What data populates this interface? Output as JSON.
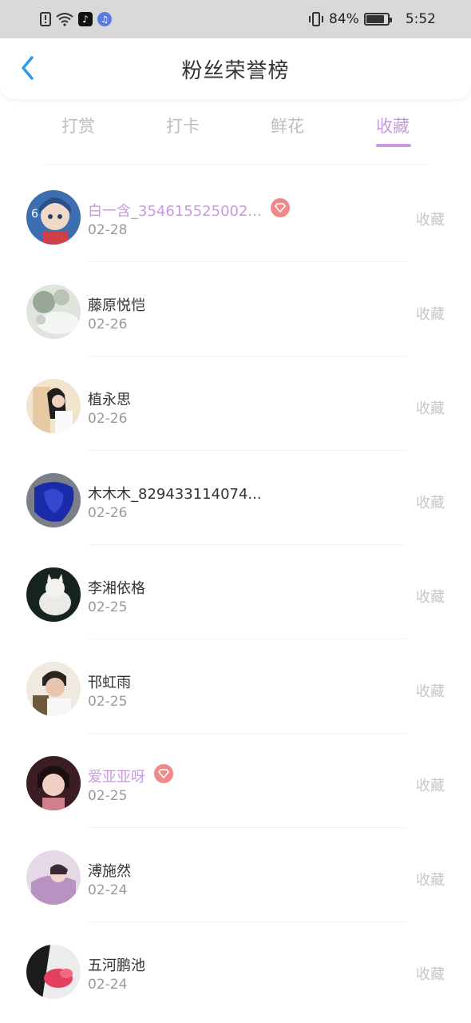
{
  "status_bar": {
    "battery": "84%",
    "time": "5:52",
    "icons": [
      "alert-icon",
      "wifi-icon",
      "tiktok-icon",
      "music-app-icon",
      "vibrate-icon",
      "battery-icon"
    ]
  },
  "header": {
    "title": "粉丝荣誉榜",
    "back_icon": "chevron-left-icon"
  },
  "tabs": [
    {
      "label": "打赏",
      "active": false
    },
    {
      "label": "打卡",
      "active": false
    },
    {
      "label": "鲜花",
      "active": false
    },
    {
      "label": "收藏",
      "active": true
    }
  ],
  "colors": {
    "accent": "#c79ae0",
    "vip_badge": "#f08a8a",
    "muted": "#c6c6c6"
  },
  "fans": [
    {
      "name": "白一含_354615525002...",
      "date": "02-28",
      "action": "收藏",
      "vip": true,
      "avatar": "avatar-illustrated-girl"
    },
    {
      "name": "藤原悦恺",
      "date": "02-26",
      "action": "收藏",
      "vip": false,
      "avatar": "avatar-flowers"
    },
    {
      "name": "植永思",
      "date": "02-26",
      "action": "收藏",
      "vip": false,
      "avatar": "avatar-anime-couple"
    },
    {
      "name": "木木木_829433114074...",
      "date": "02-26",
      "action": "收藏",
      "vip": false,
      "avatar": "avatar-blue-fabric"
    },
    {
      "name": "李湘依格",
      "date": "02-25",
      "action": "收藏",
      "vip": false,
      "avatar": "avatar-white-cat"
    },
    {
      "name": "邗虹雨",
      "date": "02-25",
      "action": "收藏",
      "vip": false,
      "avatar": "avatar-young-man"
    },
    {
      "name": "爱亚亚呀",
      "date": "02-25",
      "action": "收藏",
      "vip": true,
      "avatar": "avatar-girl-portrait"
    },
    {
      "name": "溥施然",
      "date": "02-24",
      "action": "收藏",
      "vip": false,
      "avatar": "avatar-purple-scene"
    },
    {
      "name": "五河鹏池",
      "date": "02-24",
      "action": "收藏",
      "vip": false,
      "avatar": "avatar-pink-hand"
    }
  ]
}
